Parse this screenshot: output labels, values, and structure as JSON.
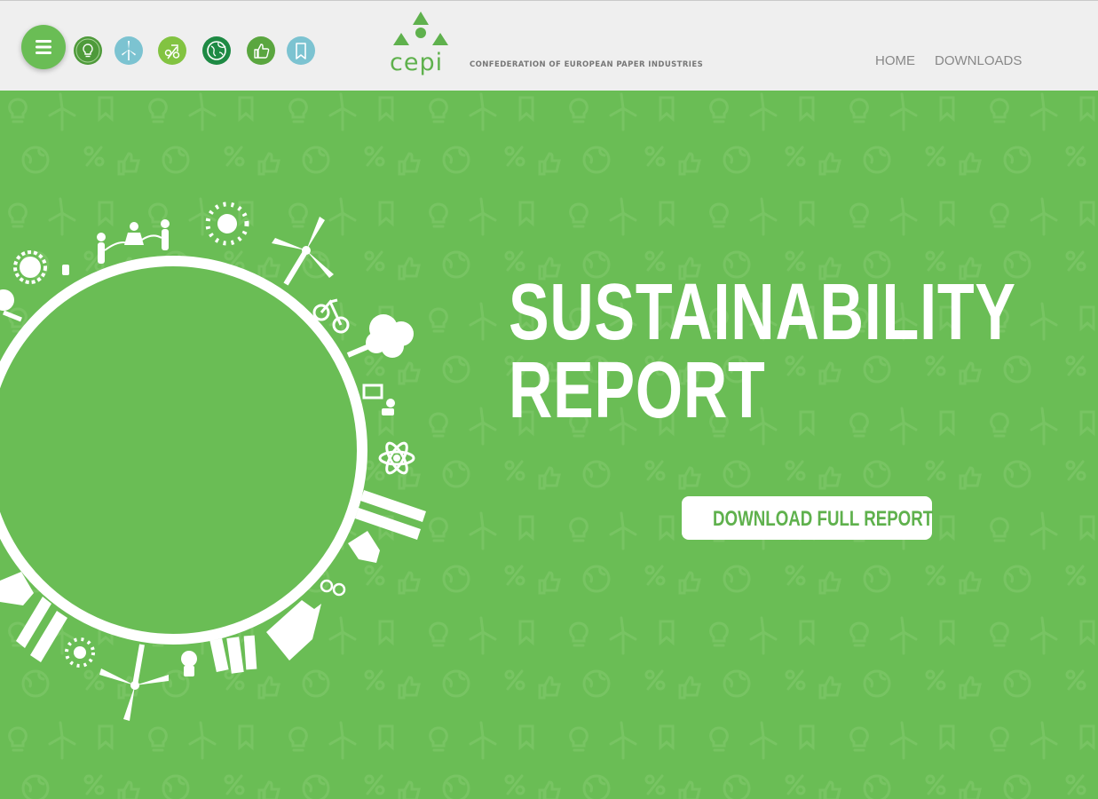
{
  "header": {
    "menu_icon": "hamburger-menu-icon",
    "category_icons": [
      {
        "name": "lightbulb-icon",
        "color": "#4e9a3a"
      },
      {
        "name": "wind-turbine-icon",
        "color": "#7cc3d1"
      },
      {
        "name": "recycle-percent-icon",
        "color": "#82c341"
      },
      {
        "name": "globe-icon",
        "color": "#1e8a44"
      },
      {
        "name": "thumbs-up-icon",
        "color": "#5aa63f"
      },
      {
        "name": "bookmark-icon",
        "color": "#7cc3d1"
      }
    ],
    "logo": {
      "word": "cepi",
      "tagline": "CONFEDERATION OF EUROPEAN PAPER INDUSTRIES"
    },
    "nav": {
      "home": "HOME",
      "downloads": "DOWNLOADS"
    }
  },
  "hero": {
    "title_line1": "SUSTAINABILITY",
    "title_line2": "REPORT",
    "cta_label": "DOWNLOAD FULL REPORT",
    "illustration": "green-globe-illustration",
    "background_color": "#6abd55",
    "accent_color": "#ffffff"
  }
}
